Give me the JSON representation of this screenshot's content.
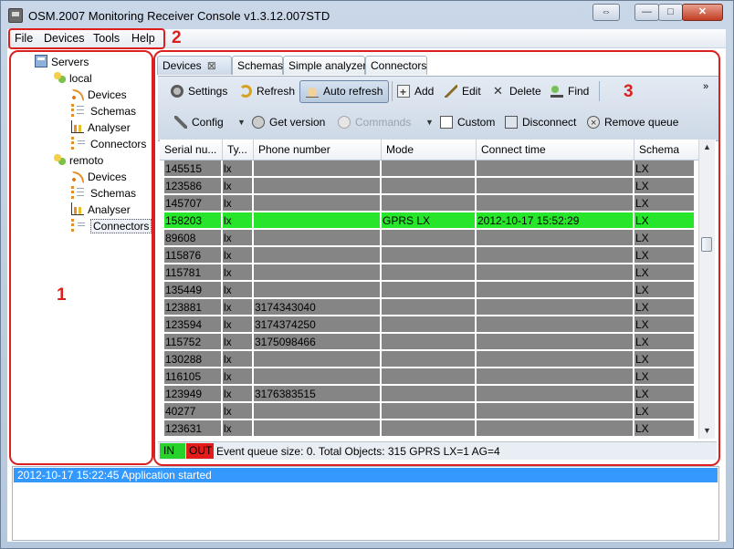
{
  "window": {
    "title": "OSM.2007 Monitoring Receiver Console v1.3.12.007STD",
    "restore_glyph": "⇔",
    "minimize_glyph": "—",
    "maximize_glyph": "□",
    "close_glyph": "✕"
  },
  "menu": {
    "file": "File",
    "devices": "Devices",
    "tools": "Tools",
    "help": "Help"
  },
  "tree": {
    "root": "Servers",
    "servers": [
      {
        "name": "local",
        "children": [
          "Devices",
          "Schemas",
          "Analyser",
          "Connectors"
        ]
      },
      {
        "name": "remoto",
        "children": [
          "Devices",
          "Schemas",
          "Analyser",
          "Connectors"
        ]
      }
    ],
    "selected": "remoto/Connectors"
  },
  "tabs": [
    {
      "label": "Devices",
      "active": true,
      "closable": true
    },
    {
      "label": "Schemas"
    },
    {
      "label": "Simple analyzer"
    },
    {
      "label": "Connectors"
    }
  ],
  "toolbar": {
    "row1": {
      "settings": "Settings",
      "refresh": "Refresh",
      "auto_refresh": "Auto refresh",
      "add": "Add",
      "edit": "Edit",
      "delete": "Delete",
      "find": "Find",
      "overflow": "»"
    },
    "row2": {
      "config": "Config",
      "get_version": "Get version",
      "commands": "Commands",
      "custom": "Custom",
      "disconnect": "Disconnect",
      "remove_queue": "Remove queue"
    }
  },
  "grid": {
    "columns": [
      "Serial nu...",
      "Ty...",
      "Phone number",
      "Mode",
      "Connect time",
      "Schema"
    ],
    "rows": [
      {
        "serial": "145515",
        "type": "lx",
        "phone": "",
        "mode": "",
        "time": "",
        "schema": "LX"
      },
      {
        "serial": "123586",
        "type": "lx",
        "phone": "",
        "mode": "",
        "time": "",
        "schema": "LX"
      },
      {
        "serial": "145707",
        "type": "lx",
        "phone": "",
        "mode": "",
        "time": "",
        "schema": "LX"
      },
      {
        "serial": "158203",
        "type": "lx",
        "phone": "",
        "mode": "GPRS LX",
        "time": "2012-10-17 15:52:29",
        "schema": "LX",
        "highlight": true
      },
      {
        "serial": "89608",
        "type": "lx",
        "phone": "",
        "mode": "",
        "time": "",
        "schema": "LX"
      },
      {
        "serial": "115876",
        "type": "lx",
        "phone": "",
        "mode": "",
        "time": "",
        "schema": "LX"
      },
      {
        "serial": "115781",
        "type": "lx",
        "phone": "",
        "mode": "",
        "time": "",
        "schema": "LX"
      },
      {
        "serial": "135449",
        "type": "lx",
        "phone": "",
        "mode": "",
        "time": "",
        "schema": "LX"
      },
      {
        "serial": "123881",
        "type": "lx",
        "phone": "3174343040",
        "mode": "",
        "time": "",
        "schema": "LX"
      },
      {
        "serial": "123594",
        "type": "lx",
        "phone": "3174374250",
        "mode": "",
        "time": "",
        "schema": "LX"
      },
      {
        "serial": "115752",
        "type": "lx",
        "phone": "3175098466",
        "mode": "",
        "time": "",
        "schema": "LX"
      },
      {
        "serial": "130288",
        "type": "lx",
        "phone": "",
        "mode": "",
        "time": "",
        "schema": "LX"
      },
      {
        "serial": "116105",
        "type": "lx",
        "phone": "",
        "mode": "",
        "time": "",
        "schema": "LX"
      },
      {
        "serial": "123949",
        "type": "lx",
        "phone": "3176383515",
        "mode": "",
        "time": "",
        "schema": "LX"
      },
      {
        "serial": "40277",
        "type": "lx",
        "phone": "",
        "mode": "",
        "time": "",
        "schema": "LX"
      },
      {
        "serial": "123631",
        "type": "lx",
        "phone": "",
        "mode": "",
        "time": "",
        "schema": "LX"
      }
    ]
  },
  "status": {
    "in": "IN",
    "out": "OUT",
    "text": "Event queue size: 0.  Total Objects: 315   GPRS LX=1    AG=4"
  },
  "log": {
    "line": "2012-10-17 15:22:45  Application started"
  },
  "annotations": {
    "one": "1",
    "two": "2",
    "three": "3"
  },
  "colors": {
    "accent_red": "#dc1f1f",
    "row_gray": "#858585",
    "row_green": "#27e52a",
    "log_blue": "#3399ff"
  }
}
